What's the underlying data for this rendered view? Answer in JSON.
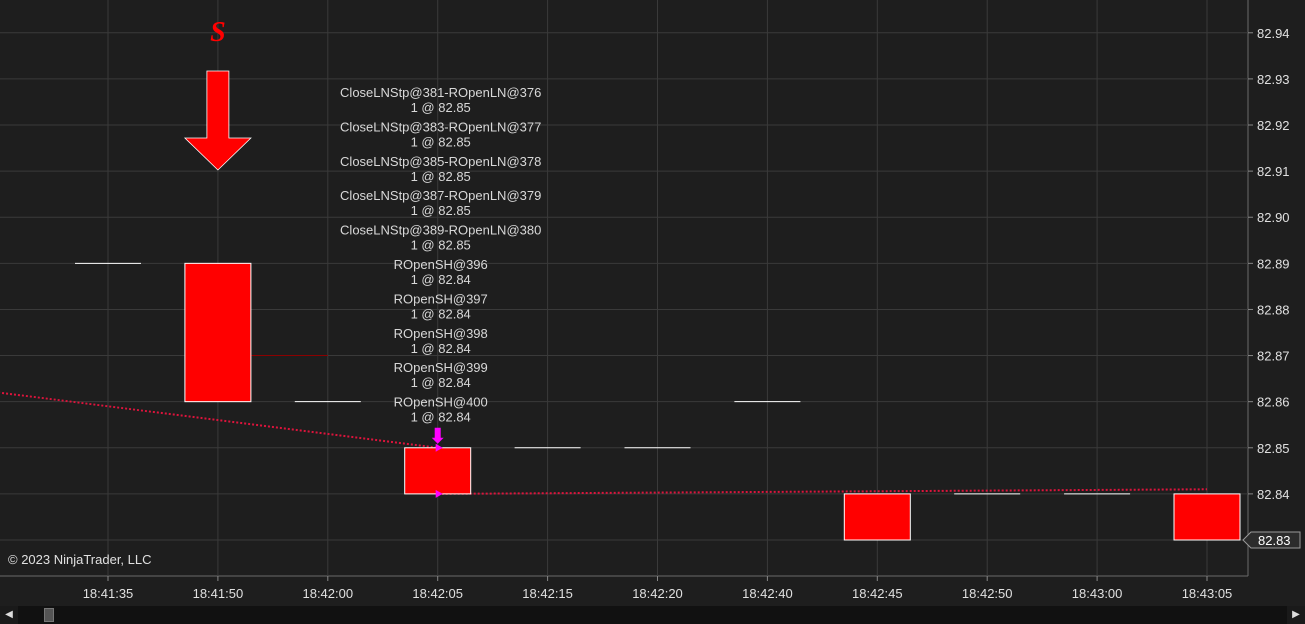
{
  "chart_data": {
    "type": "candlestick",
    "copyright": "© 2023 NinjaTrader, LLC",
    "ylim": [
      82.825,
      82.947
    ],
    "y_ticks": [
      "82.94",
      "82.93",
      "82.92",
      "82.91",
      "82.90",
      "82.89",
      "82.88",
      "82.87",
      "82.86",
      "82.85",
      "82.84",
      "82.83"
    ],
    "current_price_label": "82.83",
    "x_ticks": [
      "18:41:35",
      "18:41:50",
      "18:42:00",
      "18:42:05",
      "18:42:15",
      "18:42:20",
      "18:42:40",
      "18:42:45",
      "18:42:50",
      "18:43:00",
      "18:43:05"
    ],
    "bars": [
      {
        "x": 0,
        "open": 82.89,
        "close": 82.89
      },
      {
        "x": 1,
        "open": 82.89,
        "close": 82.86
      },
      {
        "x": 2,
        "open": 82.86,
        "close": 82.86
      },
      {
        "x": 3,
        "open": 82.85,
        "close": 82.84
      },
      {
        "x": 4,
        "open": 82.85,
        "close": 82.85
      },
      {
        "x": 5,
        "open": 82.85,
        "close": 82.85
      },
      {
        "x": 6,
        "open": 82.86,
        "close": 82.86
      },
      {
        "x": 7,
        "open": 82.84,
        "close": 82.83
      },
      {
        "x": 8,
        "open": 82.84,
        "close": 82.84
      },
      {
        "x": 9,
        "open": 82.84,
        "close": 82.84
      },
      {
        "x": 10,
        "open": 82.84,
        "close": 82.83
      }
    ],
    "signal": {
      "label": "S",
      "bar": 1,
      "direction": "down",
      "color": "#ff0000"
    },
    "horizontal_segments": [
      {
        "from": 1,
        "to": 2,
        "y": 82.87,
        "color": "#8b0000"
      }
    ],
    "trend_lines": [
      {
        "points": [
          [
            -1.0,
            82.862
          ],
          [
            3.0,
            82.85
          ]
        ],
        "color": "#dc143c"
      },
      {
        "points": [
          [
            3.0,
            82.84
          ],
          [
            10.0,
            82.841
          ]
        ],
        "color": "#dc143c"
      }
    ],
    "execution_markers": [
      {
        "bar": 3,
        "price": 82.85,
        "color": "#ff00ff"
      },
      {
        "bar": 3,
        "price": 82.84,
        "color": "#ff00ff"
      }
    ],
    "trade_labels": [
      {
        "name": "CloseLNStp@381-ROpenLN@376",
        "fill": "1 @ 82.85"
      },
      {
        "name": "CloseLNStp@383-ROpenLN@377",
        "fill": "1 @ 82.85"
      },
      {
        "name": "CloseLNStp@385-ROpenLN@378",
        "fill": "1 @ 82.85"
      },
      {
        "name": "CloseLNStp@387-ROpenLN@379",
        "fill": "1 @ 82.85"
      },
      {
        "name": "CloseLNStp@389-ROpenLN@380",
        "fill": "1 @ 82.85"
      },
      {
        "name": "ROpenSH@396",
        "fill": "1 @ 82.84"
      },
      {
        "name": "ROpenSH@397",
        "fill": "1 @ 82.84"
      },
      {
        "name": "ROpenSH@398",
        "fill": "1 @ 82.84"
      },
      {
        "name": "ROpenSH@399",
        "fill": "1 @ 82.84"
      },
      {
        "name": "ROpenSH@400",
        "fill": "1 @ 82.84"
      }
    ],
    "trade_label_bar": 3,
    "colors": {
      "background": "#1e1e1e",
      "grid": "#3a3a3a",
      "axis_text": "#e0e0e0",
      "bar_fill": "#ff0000",
      "bar_outline": "#ffffff",
      "doji": "#ffffff",
      "label_text": "#d8d8d8"
    }
  },
  "scrollbar": {
    "left_arrow_icon": "◀",
    "right_arrow_icon": "▶"
  }
}
